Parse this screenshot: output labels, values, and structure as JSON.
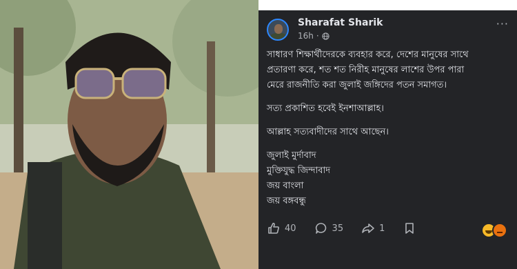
{
  "post": {
    "author": "Sharafat Sharik",
    "time": "16h",
    "dot": "·",
    "more": "···",
    "lines": [
      "সাধারণ শিক্ষার্থীদেরকে ব্যবহার করে, দেশের মানুষের সাথে",
      "প্রতারণা করে, শত শত নিরীহ মানুষের লাশের উপর পারা",
      "মেরে রাজনীতি করা জুলাই জঙ্গিদের পতন সমাগত।",
      "সত্য প্রকাশিত হবেই ইনশাআল্লাহ।",
      "আল্লাহ সত্যবাদীদের সাথে আছেন।",
      "জুলাই মুর্দাবাদ",
      "মুক্তিযুদ্ধ জিন্দাবাদ",
      "জয় বাংলা",
      "জয় বঙ্গবন্ধু"
    ],
    "likes": "40",
    "comments": "35",
    "shares": "1"
  },
  "colors": {
    "card_bg": "#232427",
    "text": "#e4e6eb",
    "muted": "#b0b3b8",
    "accent": "#2d88ff"
  },
  "icons": [
    "globe-icon",
    "more-icon",
    "like-icon",
    "comment-icon",
    "share-icon",
    "save-icon",
    "haha-reaction-icon",
    "angry-reaction-icon"
  ]
}
